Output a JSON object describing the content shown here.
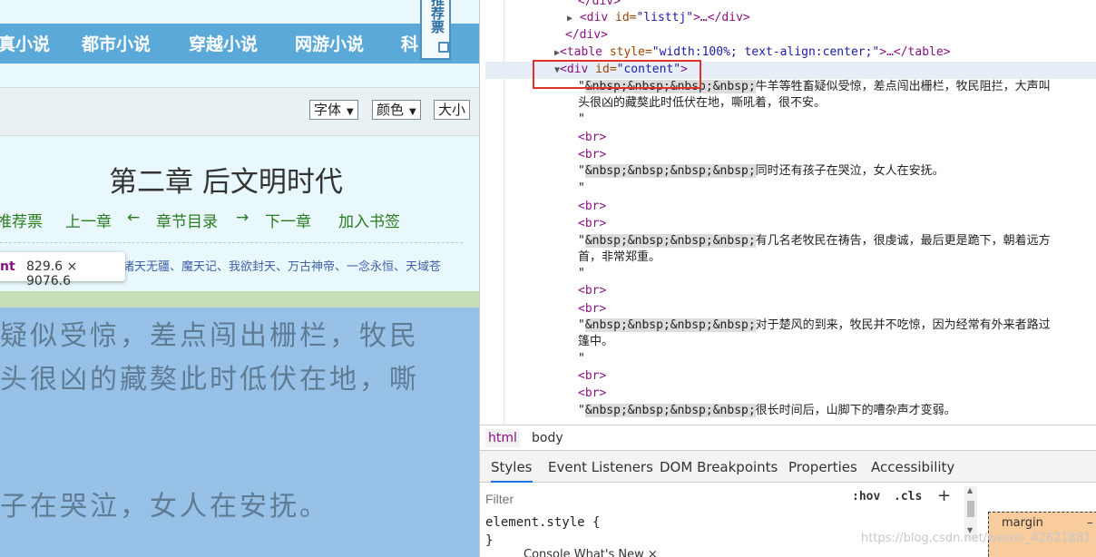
{
  "site": {
    "nav_items": [
      "真小说",
      "都市小说",
      "穿越小说",
      "网游小说",
      "科"
    ],
    "ticket_label": "推荐票",
    "toolbar_selects": [
      "字体",
      "颜色",
      "大小"
    ],
    "chapter_title": "第二章 后文明时代",
    "chapter_nav": [
      "推荐票",
      "上一章",
      "←",
      "章节目录",
      "→",
      "下一章",
      "加入书签"
    ],
    "related_books": "诸天无疆、魔天记、我欲封天、万古神帝、一念永恒、天域苍",
    "tooltip": {
      "tag": "nt",
      "dimensions": "829.6 × 9076.6"
    },
    "content_lines": [
      "疑似受惊，差点闯出栅栏，牧民",
      "头很凶的藏獒此时低伏在地，嘶",
      "子在哭泣，女人在安抚。"
    ]
  },
  "devtools": {
    "dom": {
      "line_close_div_top": "</div>",
      "listtj_open": "<div ",
      "listtj_attr": "id=",
      "listtj_val": "\"listtj\"",
      "listtj_rest": ">…</div>",
      "close_div": "</div>",
      "table_open": "<table ",
      "table_attr": "style=",
      "table_val": "\"width:100%; text-align:center;\"",
      "table_rest": ">…</table>",
      "content_open": "<div ",
      "content_attr": "id=",
      "content_val": "\"content\"",
      "content_close": ">",
      "nbsp": "&nbsp;&nbsp;&nbsp;&nbsp;",
      "p1a": "牛羊等牲畜疑似受惊，差点闯出栅栏，牧民阻拦，大声叫",
      "p1b": "头很凶的藏獒此时低伏在地，嘶吼着，很不安。",
      "p2": "同时还有孩子在哭泣，女人在安抚。",
      "p3a": "有几名老牧民在祷告，很虔诚，最后更是跪下，朝着远方",
      "p3b": "首，非常郑重。",
      "p4a": "对于楚风的到来，牧民并不吃惊，因为经常有外来者路过",
      "p4b": "篷中。",
      "p5": "很长时间后，山脚下的嘈杂声才变弱。",
      "quote": "\"",
      "br": "<br>"
    },
    "breadcrumbs": [
      "html",
      "body"
    ],
    "tabs": [
      "Styles",
      "Event Listeners",
      "DOM Breakpoints",
      "Properties",
      "Accessibility"
    ],
    "filter_placeholder": "Filter",
    "hov": ":hov",
    "cls": ".cls",
    "plus": "+",
    "element_style": "element.style {",
    "element_brace": "}",
    "margin_label": "margin",
    "margin_value": "–",
    "drawer_text": "Console   What's New   ×",
    "watermark": "https://blog.csdn.net/weixin_42621881"
  },
  "colors": {
    "nav_bg": "#5aa9d8",
    "content_highlight": "#98c1e7",
    "selection_box": "#e0342a",
    "link_green": "#2a7a1e"
  }
}
